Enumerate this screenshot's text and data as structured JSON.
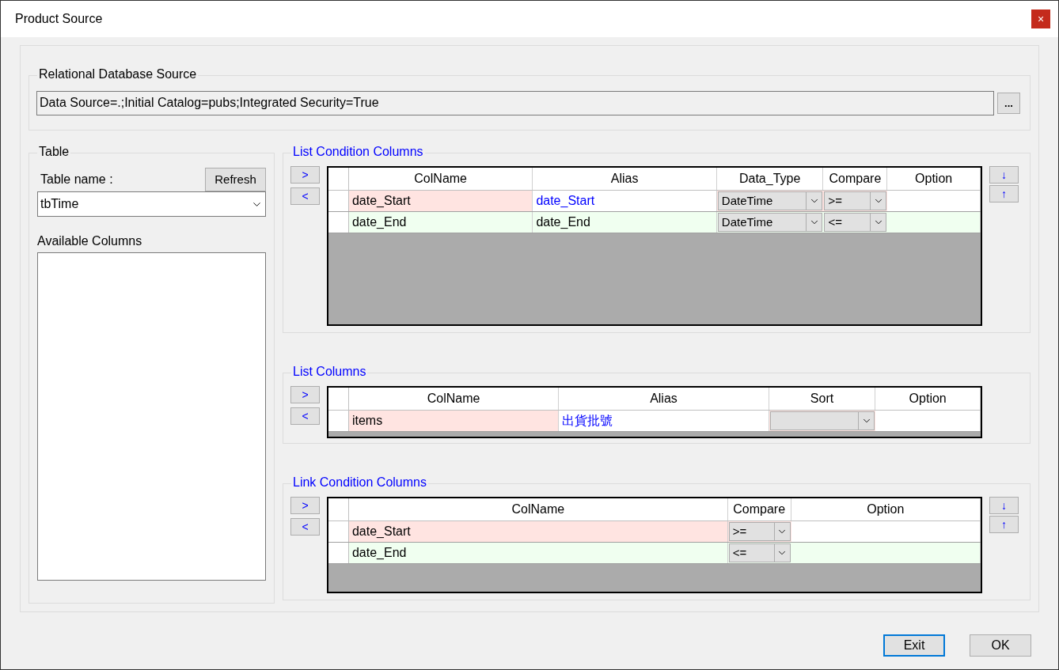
{
  "window": {
    "title": "Product Source",
    "close": "×"
  },
  "connection": {
    "label": "Relational Database Source",
    "value": "Data Source=.;Initial Catalog=pubs;Integrated Security=True",
    "browse": "..."
  },
  "table": {
    "label": "Table",
    "name_label": "Table name :",
    "refresh": "Refresh",
    "selected_table": "tbTime",
    "available_label": "Available Columns"
  },
  "sections": [
    {
      "title": "List Condition Columns",
      "add": ">",
      "remove": "<",
      "down": "↓",
      "up": "↑",
      "columns": [
        "ColName",
        "Alias",
        "Data_Type",
        "Compare",
        "Option"
      ],
      "rows": [
        {
          "color": "#ffe4e1",
          "cells": [
            {
              "kind": "text",
              "value": "date_Start",
              "accent": false
            },
            {
              "kind": "text",
              "value": "date_Start",
              "accent": true
            },
            {
              "kind": "combo",
              "value": "DateTime"
            },
            {
              "kind": "combo",
              "value": ">="
            },
            {
              "kind": "empty"
            }
          ]
        },
        {
          "color": "#f0fff0",
          "cells": [
            {
              "kind": "text",
              "value": "date_End",
              "accent": false
            },
            {
              "kind": "text",
              "value": "date_End",
              "accent": false
            },
            {
              "kind": "combo",
              "value": "DateTime"
            },
            {
              "kind": "combo",
              "value": "<="
            },
            {
              "kind": "empty"
            }
          ]
        }
      ]
    },
    {
      "title": "List Columns",
      "add": ">",
      "remove": "<",
      "columns": [
        "ColName",
        "Alias",
        "Sort",
        "Option"
      ],
      "rows": [
        {
          "color": "#ffe4e1",
          "cells": [
            {
              "kind": "text",
              "value": "items",
              "accent": false
            },
            {
              "kind": "text",
              "value": "出貨批號",
              "accent": true
            },
            {
              "kind": "combo"
            },
            {
              "kind": "empty"
            }
          ]
        }
      ]
    },
    {
      "title": "Link Condition Columns",
      "add": ">",
      "remove": "<",
      "down": "↓",
      "up": "↑",
      "columns": [
        "ColName",
        "Compare",
        "Option"
      ],
      "rows": [
        {
          "color": "#ffe4e1",
          "cells": [
            {
              "kind": "text",
              "value": "date_Start",
              "accent": false
            },
            {
              "kind": "combo",
              "value": ">="
            },
            {
              "kind": "empty"
            }
          ]
        },
        {
          "color": "#f0fff0",
          "cells": [
            {
              "kind": "text",
              "value": "date_End",
              "accent": false
            },
            {
              "kind": "combo",
              "value": "<="
            },
            {
              "kind": "empty"
            }
          ]
        }
      ]
    }
  ],
  "buttons": [
    {
      "label": "Exit",
      "focused": true
    },
    {
      "label": "OK",
      "focused": false
    }
  ]
}
